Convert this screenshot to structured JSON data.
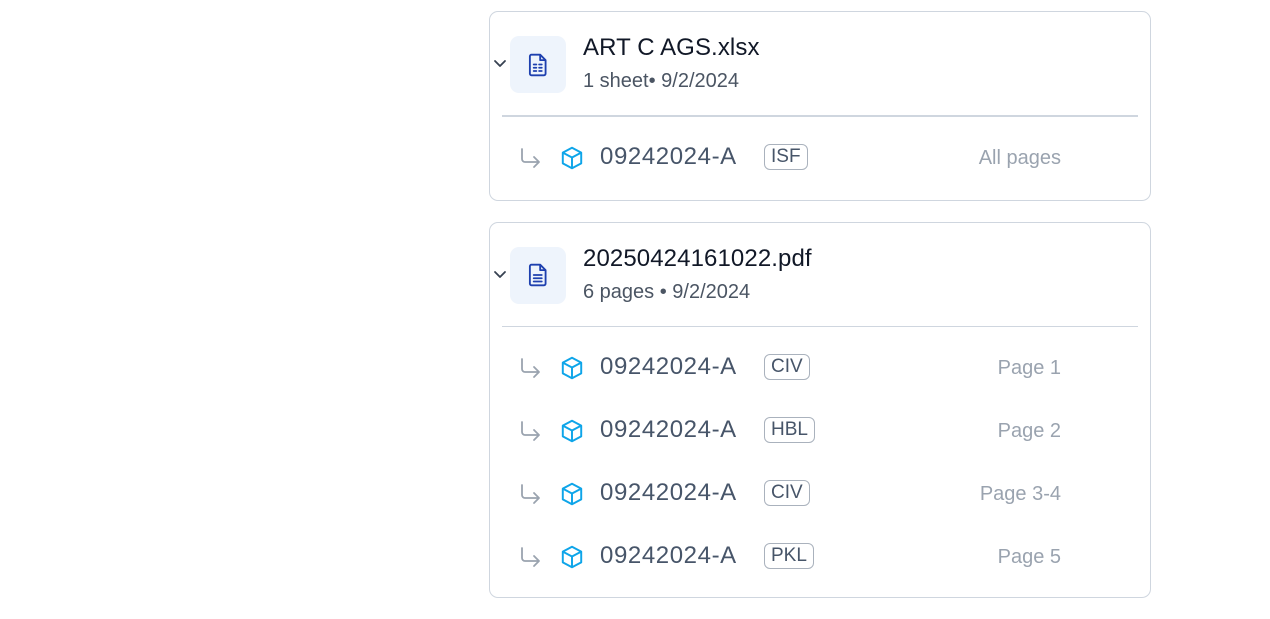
{
  "files": [
    {
      "name": "ART C AGS.xlsx",
      "meta": "1 sheet• 9/2/2024",
      "icon": "spreadsheet-file-icon",
      "documents": [
        {
          "ref": "09242024-A",
          "type": "ISF",
          "pages": "All pages"
        }
      ]
    },
    {
      "name": "20250424161022.pdf",
      "meta": "6 pages • 9/2/2024",
      "icon": "document-file-icon",
      "documents": [
        {
          "ref": "09242024-A",
          "type": "CIV",
          "pages": "Page 1"
        },
        {
          "ref": "09242024-A",
          "type": "HBL",
          "pages": "Page 2"
        },
        {
          "ref": "09242024-A",
          "type": "CIV",
          "pages": "Page 3-4"
        },
        {
          "ref": "09242024-A",
          "type": "PKL",
          "pages": "Page 5"
        }
      ]
    }
  ],
  "colors": {
    "border": "#cfd6df",
    "icon_blue": "#1e40af",
    "cube_blue": "#0ea5e9",
    "icon_bg": "#eef4fc"
  }
}
